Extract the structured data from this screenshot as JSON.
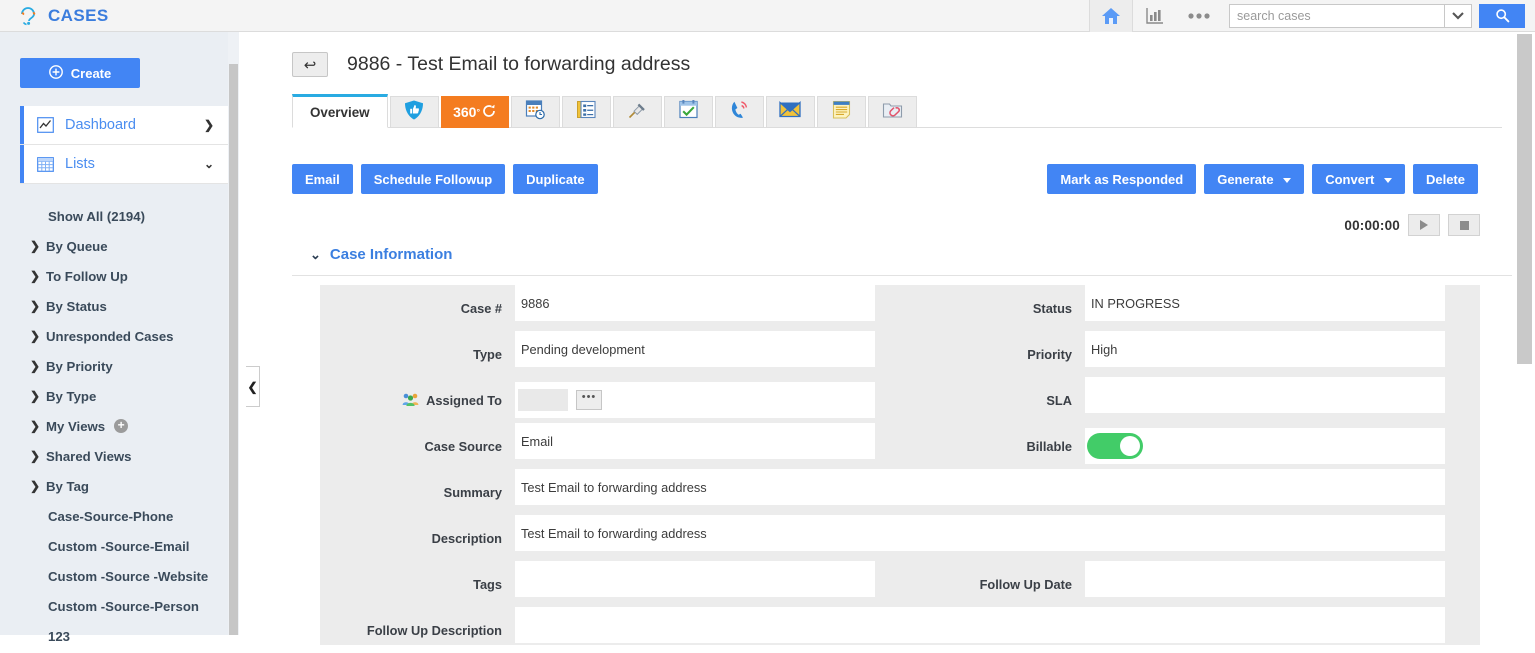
{
  "topbar": {
    "brand": "CASES",
    "brand_color": "#3b7ddd",
    "home_icon": "home-icon",
    "chart_icon": "bar-chart-icon",
    "more_icon": "ellipsis-icon",
    "search": {
      "value": "",
      "placeholder": "search cases",
      "caret_icon": "chevron-down-icon",
      "submit_icon": "search-icon"
    }
  },
  "sidebar": {
    "create_label": "Create",
    "create_icon": "plus-circle-icon",
    "main_items": [
      {
        "label": "Dashboard",
        "icon": "chart-line-icon",
        "chevron": "❯",
        "expanded": false
      },
      {
        "label": "Lists",
        "icon": "grid-table-icon",
        "chevron": "⌄",
        "expanded": true
      }
    ],
    "sub_items": [
      {
        "label": "Show All (2194)",
        "arrow": false
      },
      {
        "label": "By Queue",
        "arrow": true
      },
      {
        "label": "To Follow Up",
        "arrow": true
      },
      {
        "label": "By Status",
        "arrow": true
      },
      {
        "label": "Unresponded Cases",
        "arrow": true
      },
      {
        "label": "By Priority",
        "arrow": true
      },
      {
        "label": "By Type",
        "arrow": true
      },
      {
        "label": "My Views",
        "arrow": true,
        "plus": "+"
      },
      {
        "label": "Shared Views",
        "arrow": true
      },
      {
        "label": "By Tag",
        "arrow": true
      },
      {
        "label": "Case-Source-Phone",
        "arrow": false
      },
      {
        "label": "Custom -Source-Email",
        "arrow": false
      },
      {
        "label": "Custom -Source -Website",
        "arrow": false
      },
      {
        "label": "Custom -Source-Person",
        "arrow": false
      },
      {
        "label": "123",
        "arrow": false
      }
    ],
    "collapse_icon": "chevron-left-icon"
  },
  "page": {
    "back_icon": "back-arrow-icon",
    "title": "9886 - Test Email to forwarding address"
  },
  "tabs": [
    {
      "label": "Overview",
      "type": "text",
      "active": true
    },
    {
      "label": "",
      "type": "icon",
      "icon": "shield-thumbs-up-icon"
    },
    {
      "label": "360",
      "type": "360",
      "icon": "360-refresh-icon",
      "highlight_color": "#f47c20"
    },
    {
      "label": "",
      "type": "icon",
      "icon": "calendar-clock-icon"
    },
    {
      "label": "",
      "type": "icon",
      "icon": "form-list-icon"
    },
    {
      "label": "",
      "type": "icon",
      "icon": "push-pin-icon"
    },
    {
      "label": "",
      "type": "icon",
      "icon": "task-check-icon"
    },
    {
      "label": "",
      "type": "icon",
      "icon": "phone-ringing-icon"
    },
    {
      "label": "",
      "type": "icon",
      "icon": "envelope-icon"
    },
    {
      "label": "",
      "type": "icon",
      "icon": "notes-icon"
    },
    {
      "label": "",
      "type": "icon",
      "icon": "attachment-folder-icon"
    }
  ],
  "actions_left": [
    {
      "label": "Email"
    },
    {
      "label": "Schedule Followup"
    },
    {
      "label": "Duplicate"
    }
  ],
  "actions_right": [
    {
      "label": "Mark as Responded",
      "caret": false
    },
    {
      "label": "Generate",
      "caret": true
    },
    {
      "label": "Convert",
      "caret": true
    },
    {
      "label": "Delete",
      "caret": false
    }
  ],
  "timer": {
    "value": "00:00:00",
    "play_icon": "play-icon",
    "stop_icon": "stop-icon"
  },
  "section": {
    "chevron": "⌄",
    "title": "Case Information",
    "title_color": "#3b7fe0"
  },
  "form": {
    "case_number": {
      "label": "Case #",
      "value": "9886"
    },
    "status": {
      "label": "Status",
      "value": "IN PROGRESS"
    },
    "type": {
      "label": "Type",
      "value": "Pending development"
    },
    "priority": {
      "label": "Priority",
      "value": "High"
    },
    "assigned_to": {
      "label": "Assigned To",
      "icon": "users-group-icon",
      "value": "",
      "more_label": "•••"
    },
    "sla": {
      "label": "SLA",
      "value": ""
    },
    "case_source": {
      "label": "Case Source",
      "value": "Email"
    },
    "billable": {
      "label": "Billable",
      "value": "on",
      "on_color": "#42cc68"
    },
    "summary": {
      "label": "Summary",
      "value": "Test Email to forwarding address"
    },
    "description": {
      "label": "Description",
      "value": "Test Email to forwarding address"
    },
    "tags": {
      "label": "Tags",
      "value": ""
    },
    "follow_up_date": {
      "label": "Follow Up Date",
      "value": ""
    },
    "follow_up_description": {
      "label": "Follow Up Description",
      "value": ""
    }
  }
}
